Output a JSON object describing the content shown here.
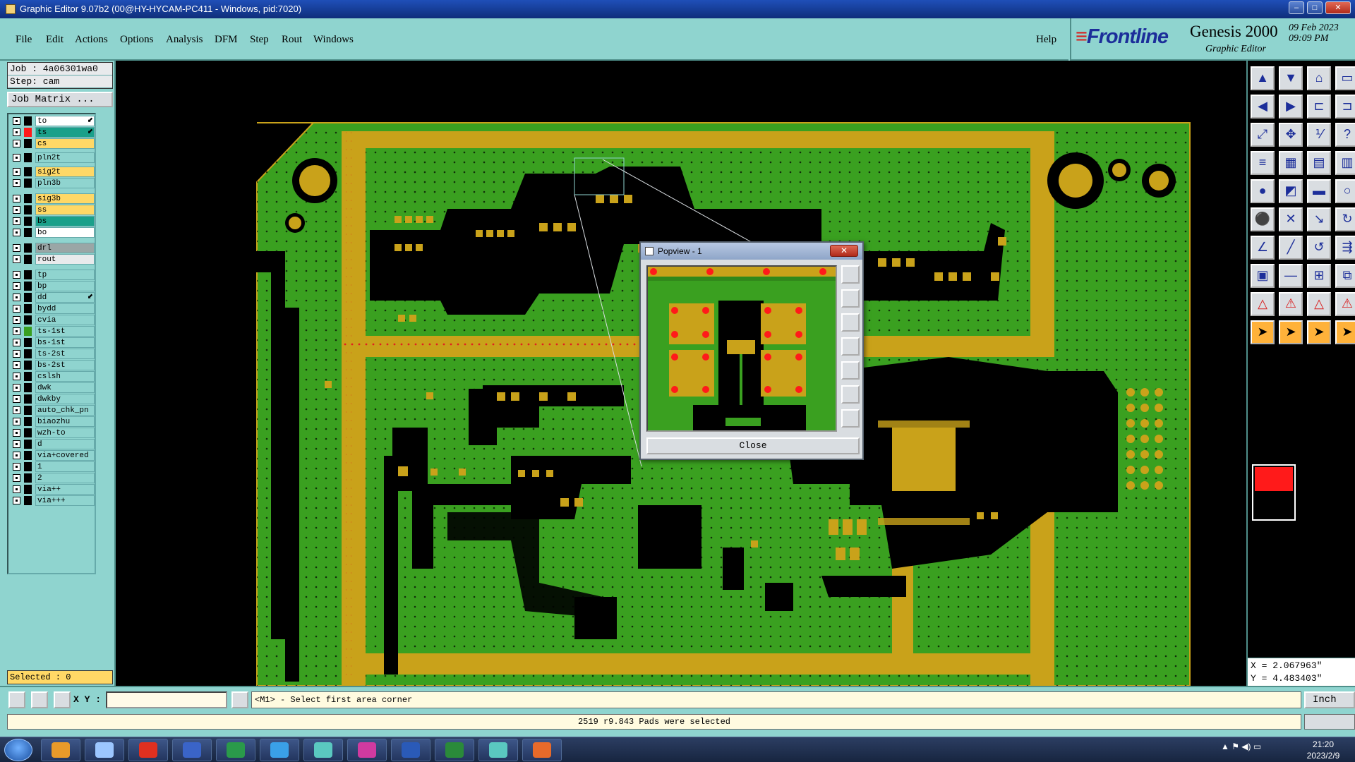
{
  "window": {
    "title": "Graphic Editor 9.07b2 (00@HY-HYCAM-PC411 - Windows, pid:7020)",
    "min": "–",
    "max": "□",
    "close": "✕"
  },
  "menu": [
    "File",
    "Edit",
    "Actions",
    "Options",
    "Analysis",
    "DFM",
    "Step",
    "Rout",
    "Windows"
  ],
  "help_label": "Help",
  "brand": {
    "logo": "Frontline",
    "product": "Genesis 2000",
    "subtitle": "Graphic Editor",
    "date": "09 Feb 2023",
    "time": "09:09 PM"
  },
  "job": {
    "job_line": "Job : 4a06301wa0",
    "step_line": "Step: cam",
    "matrix_label": "Job Matrix ..."
  },
  "layers": [
    {
      "name": "to",
      "color": "#ffffff",
      "marker": "#000000",
      "arrow": true
    },
    {
      "name": "ts",
      "color": "#1aa08a",
      "marker": "#ff1a1a",
      "arrow": true
    },
    {
      "name": "cs",
      "color": "#ffd866",
      "marker": "#000000",
      "arrow": false
    },
    {
      "name": "pln2t",
      "color": "#8fd4cf",
      "marker": "#000000",
      "arrow": false
    },
    {
      "name": "sig2t",
      "color": "#ffd866",
      "marker": "#000000",
      "arrow": false
    },
    {
      "name": "pln3b",
      "color": "#8fd4cf",
      "marker": "#000000",
      "arrow": false
    },
    {
      "name": "sig3b",
      "color": "#ffd866",
      "marker": "#000000",
      "arrow": false
    },
    {
      "name": "ss",
      "color": "#ffd866",
      "marker": "#000000",
      "arrow": false
    },
    {
      "name": "bs",
      "color": "#1aa08a",
      "marker": "#000000",
      "arrow": false
    },
    {
      "name": "bo",
      "color": "#ffffff",
      "marker": "#000000",
      "arrow": false
    },
    {
      "name": "drl",
      "color": "#9aa6a6",
      "marker": "#000000",
      "arrow": false
    },
    {
      "name": "rout",
      "color": "#e8eaec",
      "marker": "#000000",
      "arrow": false
    },
    {
      "name": "tp",
      "color": "#8fd4cf",
      "marker": "#000000",
      "arrow": false
    },
    {
      "name": "bp",
      "color": "#8fd4cf",
      "marker": "#000000",
      "arrow": false
    },
    {
      "name": "dd",
      "color": "#8fd4cf",
      "marker": "#000000",
      "arrow": true
    },
    {
      "name": "bydd",
      "color": "#8fd4cf",
      "marker": "#000000",
      "arrow": false
    },
    {
      "name": "cvia",
      "color": "#8fd4cf",
      "marker": "#000000",
      "arrow": false
    },
    {
      "name": "ts-1st",
      "color": "#8fd4cf",
      "marker": "#3aa020",
      "arrow": false
    },
    {
      "name": "bs-1st",
      "color": "#8fd4cf",
      "marker": "#000000",
      "arrow": false
    },
    {
      "name": "ts-2st",
      "color": "#8fd4cf",
      "marker": "#000000",
      "arrow": false
    },
    {
      "name": "bs-2st",
      "color": "#8fd4cf",
      "marker": "#000000",
      "arrow": false
    },
    {
      "name": "cslsh",
      "color": "#8fd4cf",
      "marker": "#000000",
      "arrow": false
    },
    {
      "name": "dwk",
      "color": "#8fd4cf",
      "marker": "#000000",
      "arrow": false
    },
    {
      "name": "dwkby",
      "color": "#8fd4cf",
      "marker": "#000000",
      "arrow": false
    },
    {
      "name": "auto_chk_pn",
      "color": "#8fd4cf",
      "marker": "#000000",
      "arrow": false
    },
    {
      "name": "biaozhu",
      "color": "#8fd4cf",
      "marker": "#000000",
      "arrow": false
    },
    {
      "name": "wzh-to",
      "color": "#8fd4cf",
      "marker": "#000000",
      "arrow": false
    },
    {
      "name": "d",
      "color": "#8fd4cf",
      "marker": "#000000",
      "arrow": false
    },
    {
      "name": "via+covered",
      "color": "#8fd4cf",
      "marker": "#000000",
      "arrow": false
    },
    {
      "name": "1",
      "color": "#8fd4cf",
      "marker": "#000000",
      "arrow": false
    },
    {
      "name": "2",
      "color": "#8fd4cf",
      "marker": "#000000",
      "arrow": false
    },
    {
      "name": "via++",
      "color": "#8fd4cf",
      "marker": "#000000",
      "arrow": false
    },
    {
      "name": "via+++",
      "color": "#8fd4cf",
      "marker": "#000000",
      "arrow": false
    }
  ],
  "selected_label": "Selected : 0",
  "popview": {
    "title": "Popview - 1",
    "close_label": "Close"
  },
  "command": {
    "xy_label": "X Y :",
    "xy_value": "",
    "prompt": "<M1> - Select first area corner",
    "unit": "Inch"
  },
  "status_message": "2519 r9.843 Pads were selected",
  "coords": {
    "x": "X = 2.067963\"",
    "y": "Y = 4.483403\""
  },
  "taskbar": {
    "time": "21:20",
    "date": "2023/2/9"
  },
  "colors": {
    "board": "#3aa020",
    "copper": "#c9a21a",
    "pad": "#c9a21a",
    "cut": "#000000",
    "highlight": "#ff1a1a",
    "panel": "#8fd4cf"
  }
}
